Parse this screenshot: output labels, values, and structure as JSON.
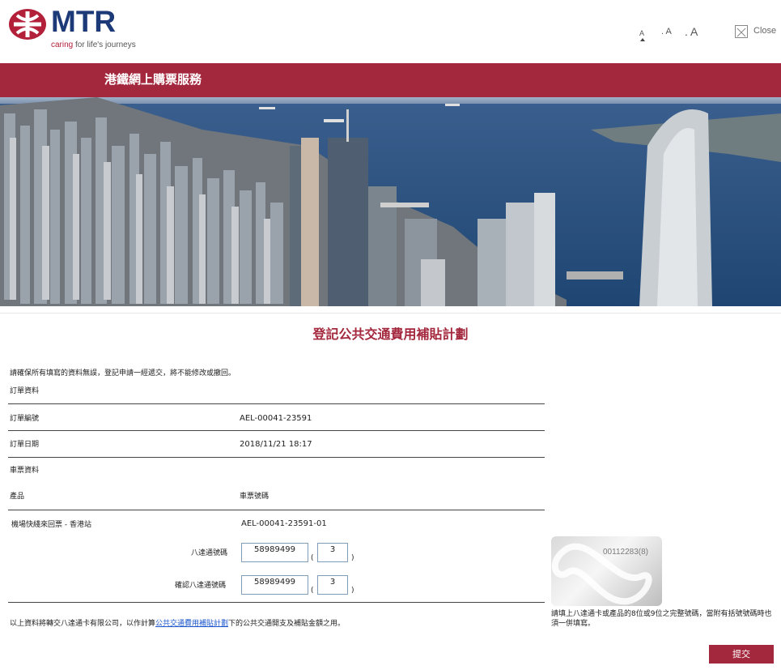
{
  "header": {
    "logo_text": "MTR",
    "tagline_accent": "caring",
    "tagline_rest": " for life's journeys",
    "font_size_options": [
      "A",
      "A",
      "A"
    ],
    "close_label": "Close"
  },
  "banner": {
    "title": "港鐵網上購票服務"
  },
  "form": {
    "title": "登記公共交通費用補貼計劃",
    "notice": "請確保所有填寫的資料無誤，登記申請一經遞交，將不能修改或撤回。",
    "order_section": "訂單資料",
    "order_number_label": "訂單編號",
    "order_number_value": "AEL-00041-23591",
    "order_date_label": "訂單日期",
    "order_date_value": "2018/11/21 18:17",
    "ticket_section": "車票資料",
    "product_col": "產品",
    "ticket_no_col": "車票號碼",
    "product_value": "機場快綫來回票 - 香港站",
    "ticket_no_value": "AEL-00041-23591-01",
    "octopus_label": "八達通號碼",
    "octopus_number": "58989499",
    "octopus_check": "3",
    "confirm_label": "確認八達通號碼",
    "confirm_number": "58989499",
    "confirm_check": "3",
    "open_paren": "(",
    "close_paren": ")",
    "consent_before": "以上資料將轉交八達通卡有限公司，以作計算",
    "consent_link": "公共交通費用補貼計劃",
    "consent_after": "下的公共交通開支及補貼金額之用。",
    "card_number": "00112283(8)",
    "card_hint": "請填上八達通卡或產品的8位或9位之完整號碼，當附有括號號碼時也須一併填寫。",
    "submit_label": "提交"
  },
  "colors": {
    "brand": "#a4283d",
    "logo_blue": "#1d3a78"
  }
}
